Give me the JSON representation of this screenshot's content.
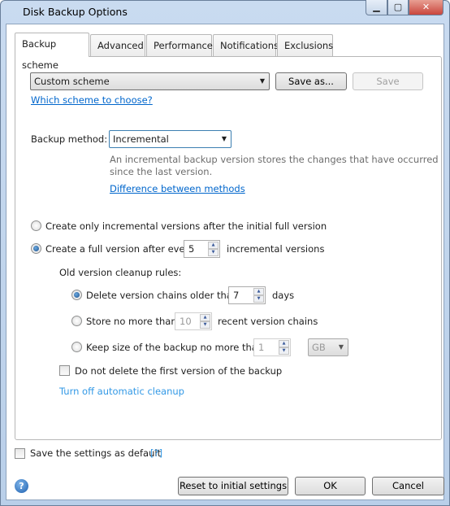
{
  "window": {
    "title": "Disk Backup Options",
    "minimize_icon": "minimize-icon",
    "maximize_icon": "maximize-icon",
    "close_icon": "close-icon"
  },
  "tabs": [
    {
      "label": "Backup scheme",
      "active": true
    },
    {
      "label": "Advanced"
    },
    {
      "label": "Performance"
    },
    {
      "label": "Notifications"
    },
    {
      "label": "Exclusions"
    }
  ],
  "scheme": {
    "selected": "Custom scheme",
    "save_as": "Save as...",
    "save": "Save",
    "help_link": "Which scheme to choose?"
  },
  "method": {
    "label": "Backup method:",
    "selected": "Incremental",
    "description_1": "An incremental backup version stores the changes that have occurred",
    "description_2": "since the last version.",
    "link": "Difference between methods"
  },
  "options": {
    "only_incremental": "Create only incremental versions after the initial full version",
    "full_after_prefix": "Create a full version after every",
    "full_after_value": "5",
    "full_after_suffix": "incremental versions"
  },
  "cleanup": {
    "title": "Old version cleanup rules:",
    "older_than_label": "Delete version chains older than",
    "older_than_value": "7",
    "older_than_unit": "days",
    "store_label": "Store no more than",
    "store_value": "10",
    "store_suffix": "recent version chains",
    "size_label": "Keep size of the backup no more than",
    "size_value": "1",
    "size_unit": "GB",
    "keep_first": "Do not delete the first version of the backup",
    "turn_off": "Turn off automatic cleanup"
  },
  "footer": {
    "save_default": "Save the settings as default",
    "help": "[?]",
    "reset": "Reset to initial settings",
    "ok": "OK",
    "cancel": "Cancel"
  },
  "colors": {
    "link": "#0066cc",
    "frame": "#c9dbf0",
    "close": "#c9463d"
  }
}
